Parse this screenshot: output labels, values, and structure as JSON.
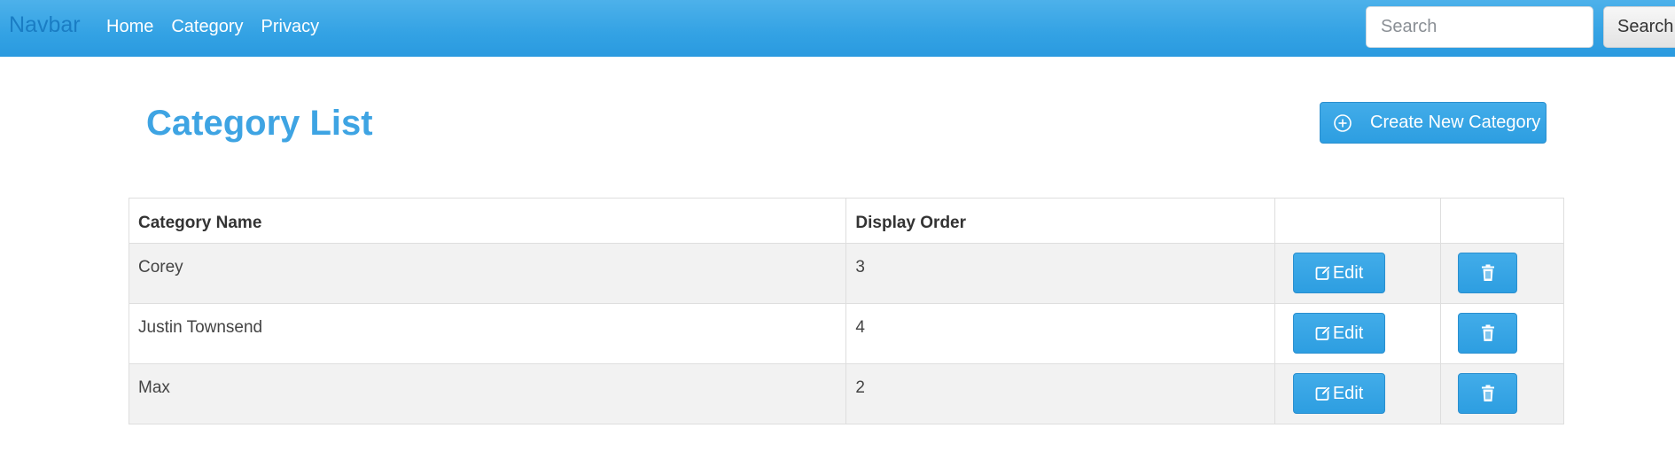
{
  "navbar": {
    "brand": "Navbar",
    "links": [
      "Home",
      "Category",
      "Privacy"
    ],
    "search_placeholder": "Search",
    "search_button": "Search"
  },
  "header": {
    "title": "Category List",
    "create_button": "Create New Category"
  },
  "table": {
    "columns": [
      "Category Name",
      "Display Order",
      "",
      ""
    ],
    "rows": [
      {
        "name": "Corey",
        "display_order": "3"
      },
      {
        "name": "Justin Townsend",
        "display_order": "4"
      },
      {
        "name": "Max",
        "display_order": "2"
      }
    ],
    "edit_label": "Edit"
  },
  "colors": {
    "navbar": "#33a2e4",
    "brand": "#1a7dc4",
    "title": "#3ea4e3",
    "button": "#2d9ee1"
  },
  "icons": {
    "create": "plus-circle-icon",
    "edit": "pencil-square-icon",
    "delete": "trash-icon"
  }
}
